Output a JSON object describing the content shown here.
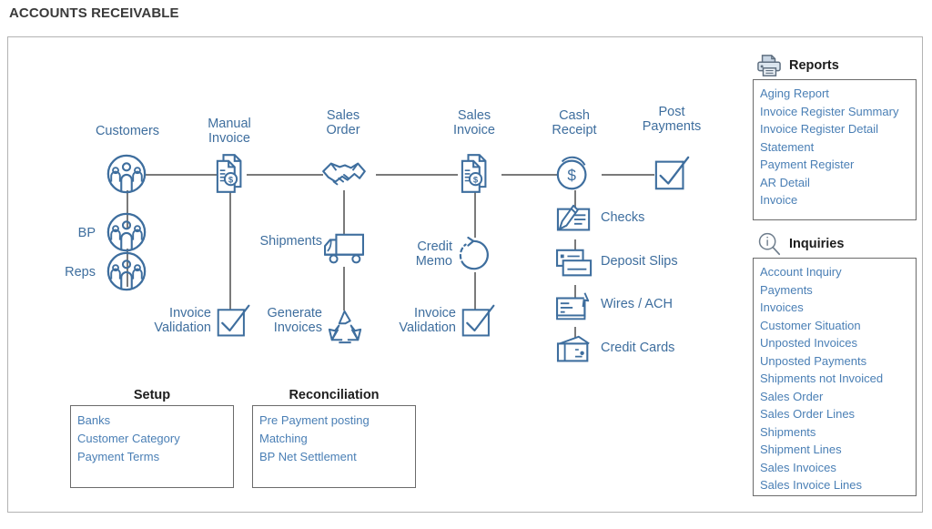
{
  "page": {
    "title": "ACCOUNTS RECEIVABLE",
    "accent_blue": "#3e6e9e",
    "link_blue": "#4a7fb5",
    "connector_gray": "#7a7a7a",
    "border_gray": "#6b6b6b"
  },
  "flow": {
    "nodes": [
      {
        "id": "customers",
        "label": "Customers",
        "icon": "people-circle-icon"
      },
      {
        "id": "manual-invoice",
        "label": "Manual\nInvoice",
        "icon": "invoice-dollar-icon"
      },
      {
        "id": "sales-order",
        "label": "Sales\nOrder",
        "icon": "handshake-icon"
      },
      {
        "id": "sales-invoice",
        "label": "Sales\nInvoice",
        "icon": "invoice-dollar-icon"
      },
      {
        "id": "cash-receipt",
        "label": "Cash\nReceipt",
        "icon": "coin-dollar-icon"
      },
      {
        "id": "post-payments",
        "label": "Post\nPayments",
        "icon": "checkbox-check-icon"
      }
    ],
    "branches": [
      {
        "id": "bp",
        "label": "BP",
        "icon": "people-circle-icon"
      },
      {
        "id": "reps",
        "label": "Reps",
        "icon": "people-circle-icon"
      },
      {
        "id": "invoice-validation-manual",
        "label": "Invoice\nValidation",
        "icon": "checkbox-check-icon"
      },
      {
        "id": "shipments",
        "label": "Shipments",
        "icon": "truck-icon"
      },
      {
        "id": "generate-invoices",
        "label": "Generate\nInvoices",
        "icon": "recycle-icon"
      },
      {
        "id": "credit-memo",
        "label": "Credit\nMemo",
        "icon": "circular-arrow-icon"
      },
      {
        "id": "invoice-validation-sales",
        "label": "Invoice\nValidation",
        "icon": "checkbox-check-icon"
      },
      {
        "id": "checks",
        "label": "Checks",
        "icon": "check-pen-icon"
      },
      {
        "id": "deposit-slips",
        "label": "Deposit Slips",
        "icon": "deposit-slip-icon"
      },
      {
        "id": "wires-ach",
        "label": "Wires / ACH",
        "icon": "wire-transfer-icon"
      },
      {
        "id": "credit-cards",
        "label": "Credit Cards",
        "icon": "credit-card-wallet-icon"
      }
    ]
  },
  "reports": {
    "title": "Reports",
    "icon": "printer-icon",
    "items": [
      "Aging Report",
      "Invoice Register Summary",
      "Invoice Register Detail",
      "Statement",
      "Payment Register",
      "AR Detail",
      "Invoice"
    ]
  },
  "inquiries": {
    "title": "Inquiries",
    "icon": "magnifier-info-icon",
    "items": [
      "Account Inquiry",
      "Payments",
      "Invoices",
      "Customer Situation",
      "Unposted Invoices",
      "Unposted Payments",
      "Shipments not Invoiced",
      "Sales Order",
      "Sales Order Lines",
      "Shipments",
      "Shipment Lines",
      "Sales Invoices",
      "Sales Invoice Lines"
    ]
  },
  "setup": {
    "title": "Setup",
    "items": [
      "Banks",
      "Customer Category",
      "Payment Terms"
    ]
  },
  "reconciliation": {
    "title": "Reconciliation",
    "items": [
      "Pre Payment posting",
      "Matching",
      "BP Net Settlement"
    ]
  }
}
